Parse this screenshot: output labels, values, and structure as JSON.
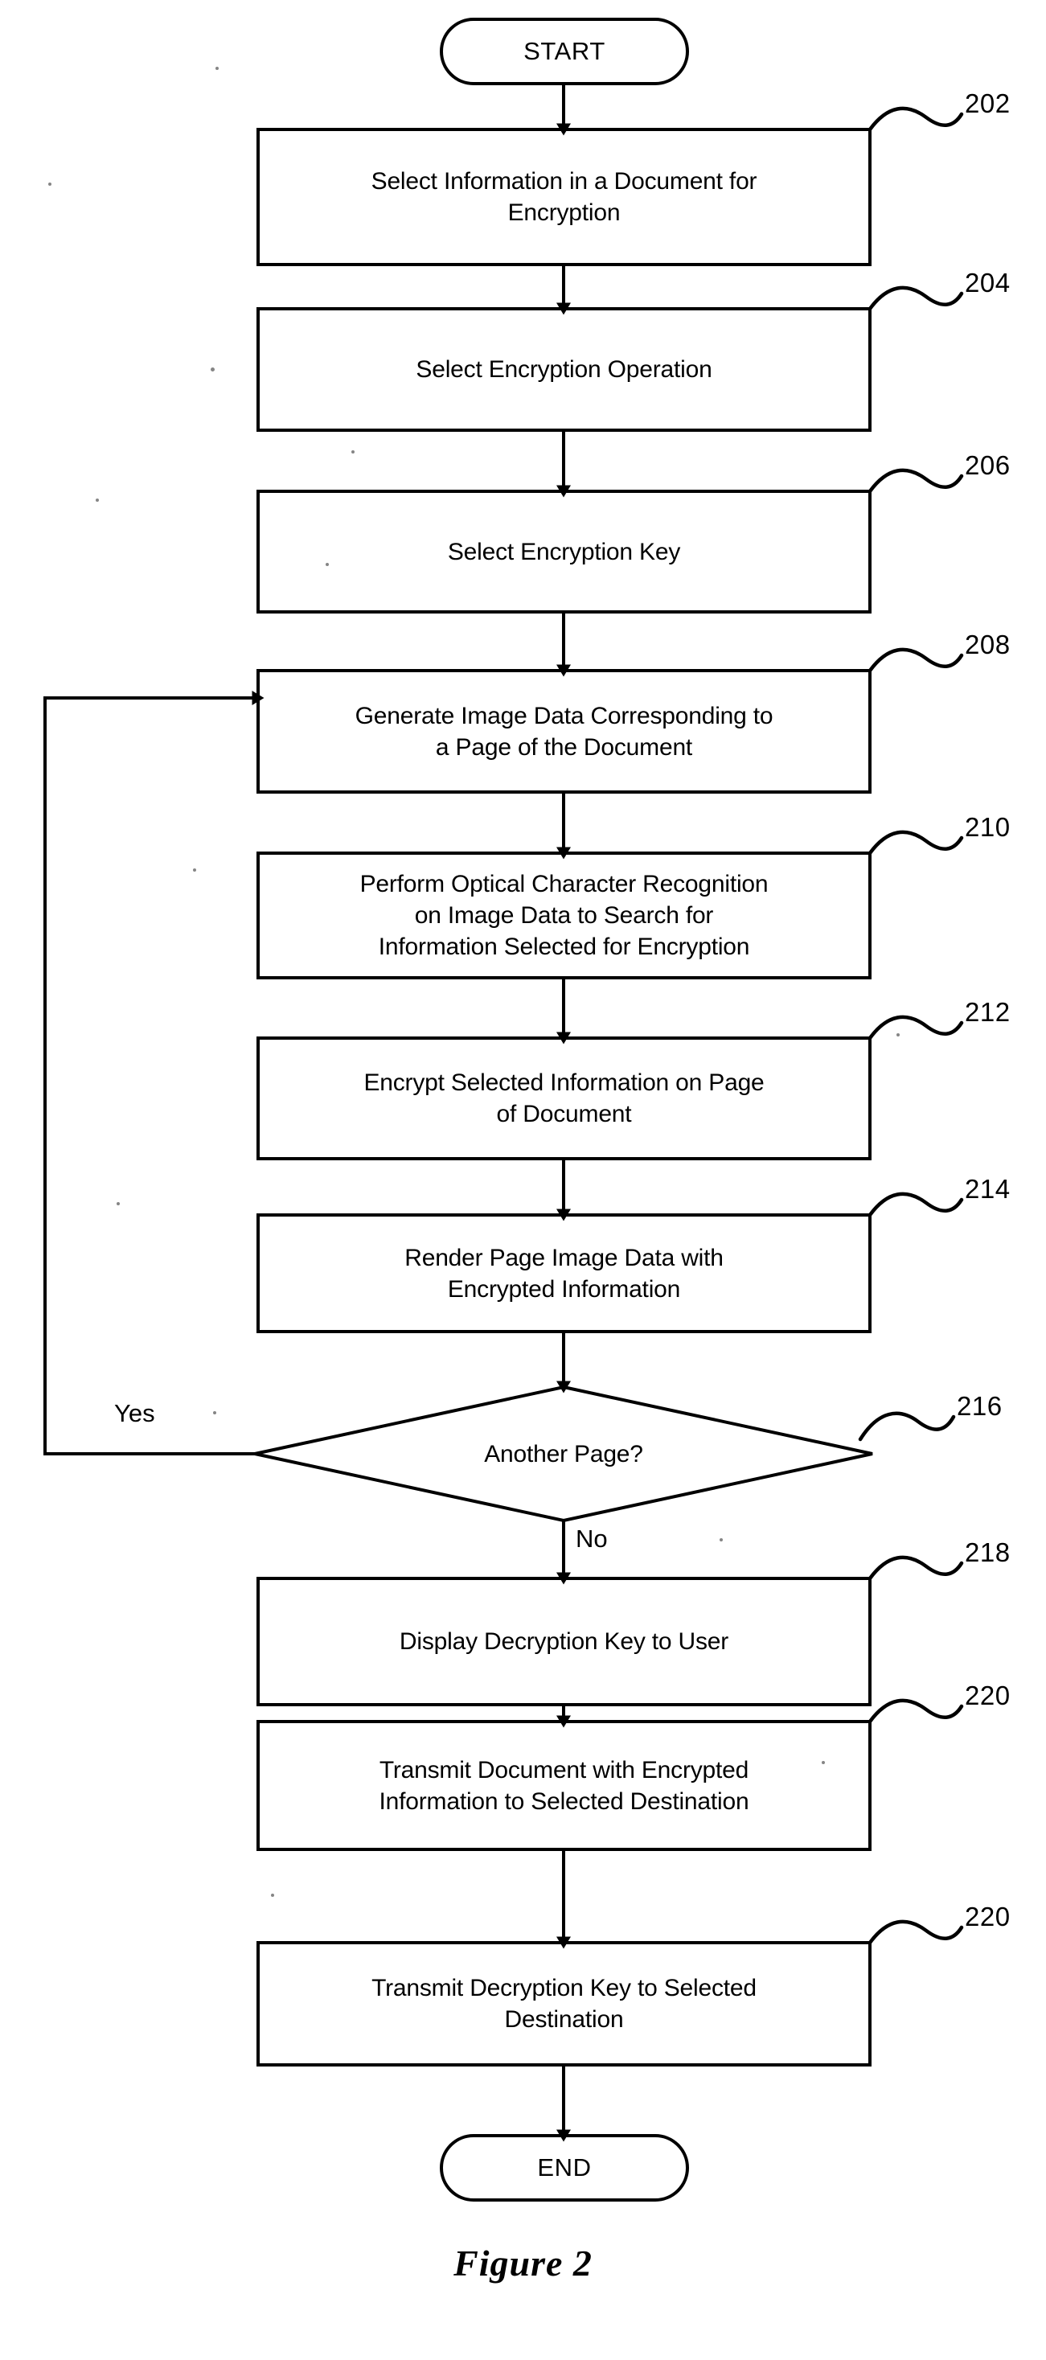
{
  "figure": {
    "caption": "Figure 2",
    "start_label": "START",
    "end_label": "END"
  },
  "nodes": [
    {
      "id": "start",
      "shape": "terminator",
      "label": "START",
      "ref": null
    },
    {
      "id": "n202",
      "shape": "process",
      "label": "Select Information in a Document for\nEncryption",
      "ref": "202"
    },
    {
      "id": "n204",
      "shape": "process",
      "label": "Select Encryption Operation",
      "ref": "204"
    },
    {
      "id": "n206",
      "shape": "process",
      "label": "Select Encryption Key",
      "ref": "206"
    },
    {
      "id": "n208",
      "shape": "process",
      "label": "Generate Image Data Corresponding to\na Page of the Document",
      "ref": "208"
    },
    {
      "id": "n210",
      "shape": "process",
      "label": "Perform Optical Character Recognition\non Image Data to Search for\nInformation Selected for Encryption",
      "ref": "210"
    },
    {
      "id": "n212",
      "shape": "process",
      "label": "Encrypt Selected Information on Page\nof Document",
      "ref": "212"
    },
    {
      "id": "n214",
      "shape": "process",
      "label": "Render Page Image Data with\nEncrypted Information",
      "ref": "214"
    },
    {
      "id": "n216",
      "shape": "decision",
      "label": "Another Page?",
      "ref": "216"
    },
    {
      "id": "n218",
      "shape": "process",
      "label": "Display Decryption Key to User",
      "ref": "218"
    },
    {
      "id": "n220a",
      "shape": "process",
      "label": "Transmit Document with Encrypted\nInformation to Selected Destination",
      "ref": "220"
    },
    {
      "id": "n220b",
      "shape": "process",
      "label": "Transmit Decryption Key to Selected\nDestination",
      "ref": "220"
    },
    {
      "id": "end",
      "shape": "terminator",
      "label": "END",
      "ref": null
    }
  ],
  "edge_labels": {
    "yes": "Yes",
    "no": "No"
  },
  "colors": {
    "ink": "#000000",
    "paper": "#ffffff"
  }
}
